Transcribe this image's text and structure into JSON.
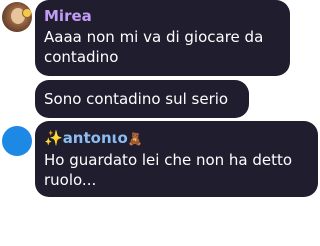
{
  "messages": [
    {
      "author": "Mirea",
      "avatar_icon": "user-avatar-photo",
      "avatar_badge_icon": "smiley-badge-icon",
      "text": "Aaaa non mi va di giocare da\ncontadino",
      "name_color": "#c39cf6"
    },
    {
      "author": "",
      "text": "Sono contadino sul serio"
    },
    {
      "author_prefix": "✨",
      "author": "antonιo",
      "author_suffix": "🧸",
      "avatar_icon": "user-avatar-default",
      "avatar_color": "#1e88e5",
      "text": "Ho guardato lei che non ha detto\nruolo...",
      "name_color": "#8bbcf0"
    }
  ],
  "colors": {
    "bubble_bg": "#1f1d2e",
    "bubble_text": "#ffffff",
    "page_bg": "#ffffff"
  }
}
